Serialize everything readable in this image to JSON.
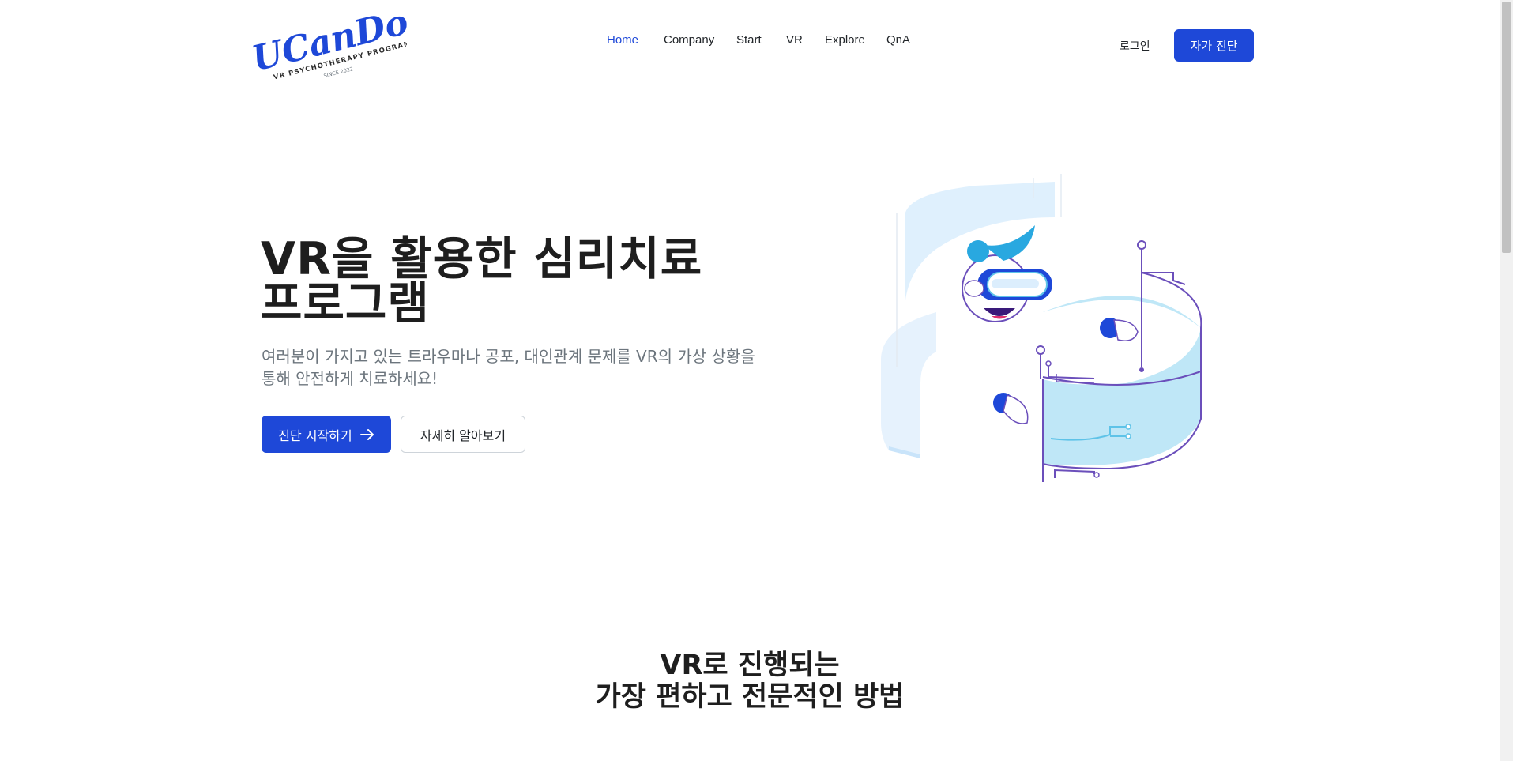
{
  "brand": {
    "logo_text": "UCanDoit!",
    "logo_tagline": "VR PSYCHOTHERAPY PROGRAM",
    "logo_since": "SINCE 2022",
    "accent_color": "#1e48d8"
  },
  "nav": {
    "items": [
      {
        "label": "Home",
        "active": true
      },
      {
        "label": "Company"
      },
      {
        "label": "Start"
      },
      {
        "label": "VR"
      },
      {
        "label": "Explore"
      },
      {
        "label": "QnA"
      }
    ],
    "login_label": "로그인",
    "self_check_label": "자가 진단"
  },
  "hero": {
    "title_line1": "VR을 활용한 심리치료",
    "title_line2": "프로그램",
    "subtitle_line1": "여러분이 가지고 있는 트라우마나 공포, 대인관계 문제를 VR의 가상 상황을",
    "subtitle_line2": "통해 안전하게 치료하세요!",
    "primary_button": "진단 시작하기",
    "primary_button_icon": "arrow-right-icon",
    "secondary_button": "자세히 알아보기"
  },
  "section": {
    "title_line1": "VR로 진행되는",
    "title_line2": "가장 편하고 전문적인 방법"
  }
}
